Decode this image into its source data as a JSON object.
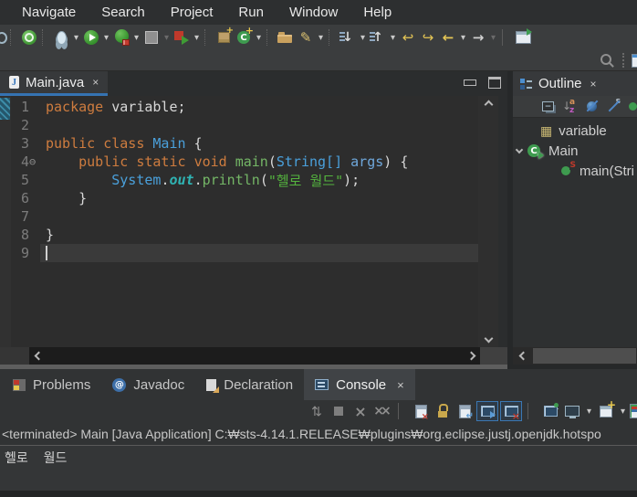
{
  "menu": {
    "items": [
      "Navigate",
      "Search",
      "Project",
      "Run",
      "Window",
      "Help"
    ]
  },
  "icons": {
    "close": "×",
    "dropdown": "▾"
  },
  "editor": {
    "tab": {
      "title": "Main.java"
    },
    "lines": [
      {
        "n": "1",
        "t": [
          [
            "package",
            "kw"
          ],
          [
            " variable;",
            "pl"
          ]
        ]
      },
      {
        "n": "2",
        "t": []
      },
      {
        "n": "3",
        "t": [
          [
            "public",
            "kw"
          ],
          [
            " ",
            "pl"
          ],
          [
            "class",
            "kw"
          ],
          [
            " ",
            "pl"
          ],
          [
            "Main",
            "typ"
          ],
          [
            " {",
            "pl"
          ]
        ]
      },
      {
        "n": "4",
        "fold": "⊖",
        "t": [
          [
            "    ",
            "pl"
          ],
          [
            "public",
            "kw"
          ],
          [
            " ",
            "pl"
          ],
          [
            "static",
            "kw"
          ],
          [
            " ",
            "pl"
          ],
          [
            "void",
            "kw"
          ],
          [
            " ",
            "pl"
          ],
          [
            "main",
            "grn"
          ],
          [
            "(",
            "pl"
          ],
          [
            "String[]",
            "typ"
          ],
          [
            " ",
            "pl"
          ],
          [
            "args",
            "prm"
          ],
          [
            ") {",
            "pl"
          ]
        ]
      },
      {
        "n": "5",
        "t": [
          [
            "        ",
            "pl"
          ],
          [
            "System",
            "typ"
          ],
          [
            ".",
            "pl"
          ],
          [
            "out",
            "fld"
          ],
          [
            ".",
            "pl"
          ],
          [
            "println",
            "grn"
          ],
          [
            "(",
            "pl"
          ],
          [
            "\"헬로 월드\"",
            "str"
          ],
          [
            ");",
            "pl"
          ]
        ]
      },
      {
        "n": "6",
        "t": [
          [
            "    }",
            "pl"
          ]
        ]
      },
      {
        "n": "7",
        "t": []
      },
      {
        "n": "8",
        "t": [
          [
            "}",
            "pl"
          ]
        ]
      },
      {
        "n": "9",
        "t": [],
        "cur": true
      }
    ]
  },
  "outline": {
    "tab": "Outline",
    "items": [
      {
        "label": "variable",
        "icon": "package",
        "indent": 30,
        "chevron": false
      },
      {
        "label": "Main",
        "icon": "class",
        "indent": 4,
        "chevron": true
      },
      {
        "label": "main(Stri",
        "icon": "method",
        "indent": 53,
        "chevron": false
      }
    ]
  },
  "bottom": {
    "tabs": [
      {
        "label": "Problems",
        "icon": "problems",
        "active": false
      },
      {
        "label": "Javadoc",
        "icon": "javadoc",
        "active": false
      },
      {
        "label": "Declaration",
        "icon": "declaration",
        "active": false
      },
      {
        "label": "Console",
        "icon": "console",
        "active": true
      }
    ],
    "console": {
      "title": "<terminated> Main [Java Application] C:₩sts-4.14.1.RELEASE₩plugins₩org.eclipse.justj.openjdk.hotspo",
      "output": "헬로  월드"
    }
  }
}
